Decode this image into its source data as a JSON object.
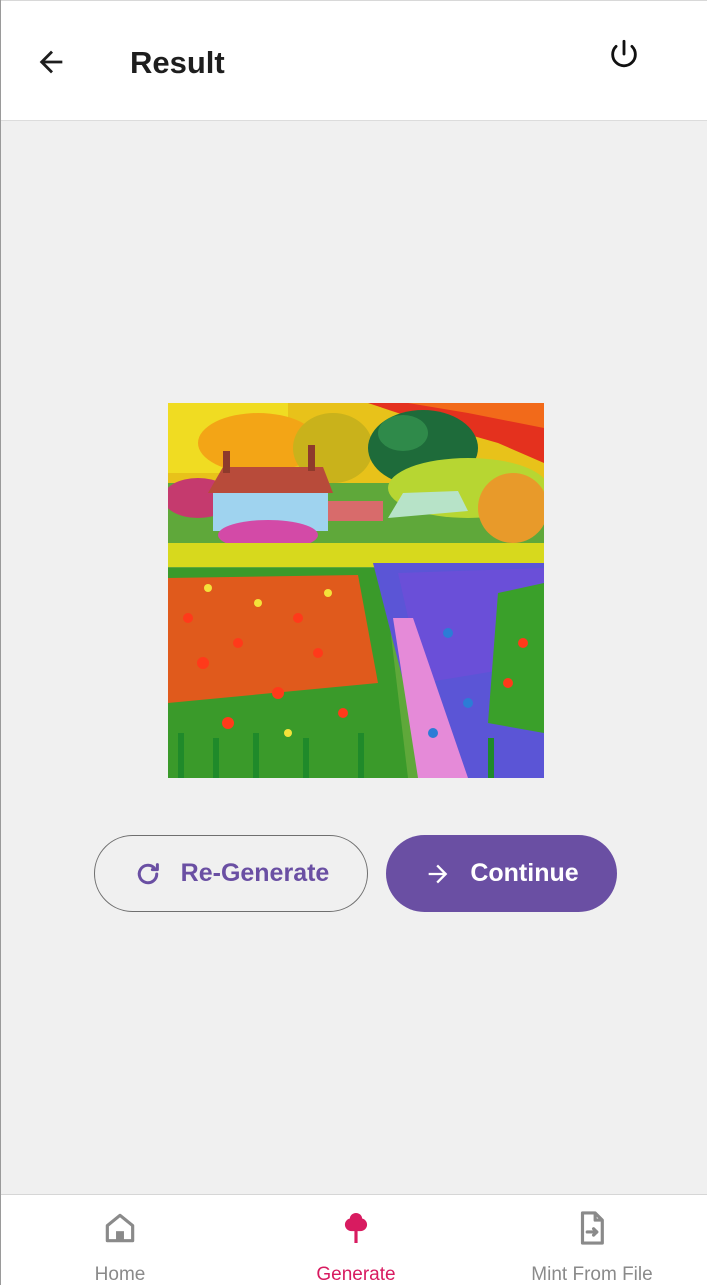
{
  "header": {
    "title": "Result",
    "back_icon": "arrow-left-icon",
    "power_icon": "power-icon"
  },
  "main": {
    "image_alt": "Impressionist painting of a cottage beside a colorful flower field"
  },
  "actions": {
    "regenerate_label": "Re-Generate",
    "continue_label": "Continue"
  },
  "bottom_nav": {
    "home_label": "Home",
    "generate_label": "Generate",
    "mint_label": "Mint From File",
    "active": "Generate"
  },
  "colors": {
    "accent": "#6a4fa3",
    "active_nav": "#d81b60",
    "inactive_nav": "#8a8a8a"
  }
}
